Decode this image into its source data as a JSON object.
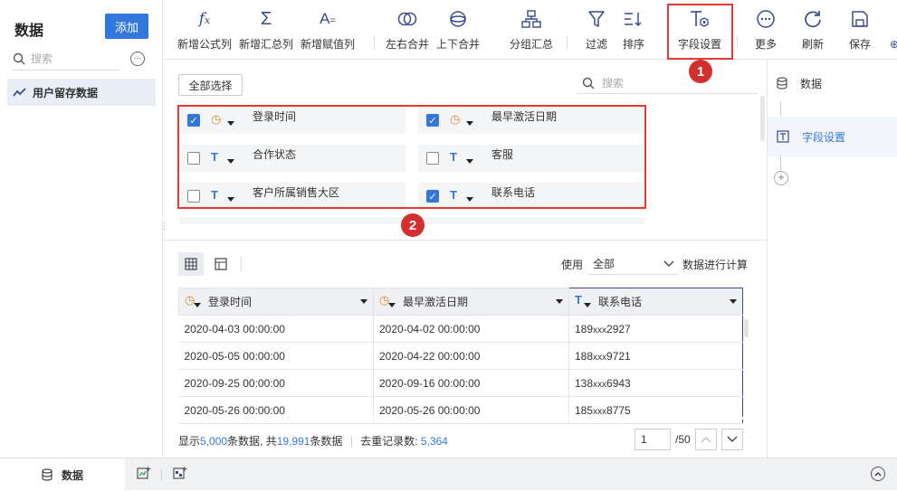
{
  "sidebar": {
    "title": "数据",
    "add_label": "添加",
    "search_placeholder": "搜索",
    "more_icon": "ellipsis-circle-icon",
    "items": [
      {
        "label": "用户留存数据",
        "icon": "line-chart-icon"
      }
    ]
  },
  "toolbar": {
    "items": [
      {
        "label": "新增公式列",
        "icon": "formula-icon"
      },
      {
        "label": "新增汇总列",
        "icon": "sigma-icon"
      },
      {
        "label": "新增赋值列",
        "icon": "assign-icon"
      },
      {
        "label": "左右合并",
        "icon": "merge-horizontal-icon"
      },
      {
        "label": "上下合并",
        "icon": "merge-vertical-icon"
      },
      {
        "label": "分组汇总",
        "icon": "group-summary-icon"
      },
      {
        "label": "过滤",
        "icon": "filter-icon"
      },
      {
        "label": "排序",
        "icon": "sort-icon"
      },
      {
        "label": "字段设置",
        "icon": "field-settings-icon"
      },
      {
        "label": "更多",
        "icon": "more-icon"
      },
      {
        "label": "刷新",
        "icon": "refresh-icon"
      },
      {
        "label": "保存",
        "icon": "save-icon"
      }
    ],
    "badge_1": "1"
  },
  "field_panel": {
    "select_all_label": "全部选择",
    "search_placeholder": "搜索",
    "badge_2": "2",
    "fields": [
      {
        "name": "登录时间",
        "type": "time",
        "checked": true
      },
      {
        "name": "最早激活日期",
        "type": "time",
        "checked": true
      },
      {
        "name": "合作状态",
        "type": "text",
        "checked": false
      },
      {
        "name": "客服",
        "type": "text",
        "checked": false
      },
      {
        "name": "客户所属销售大区",
        "type": "text",
        "checked": false
      },
      {
        "name": "联系电话",
        "type": "text",
        "checked": true
      }
    ]
  },
  "preview": {
    "use_label": "使用",
    "use_value": "全部",
    "calc_label": "数据进行计算",
    "columns": [
      {
        "name": "登录时间",
        "type": "time"
      },
      {
        "name": "最早激活日期",
        "type": "time"
      },
      {
        "name": "联系电话",
        "type": "text"
      }
    ],
    "rows": [
      {
        "c1": "2020-04-03 00:00:00",
        "c2": "2020-04-02 00:00:00",
        "p1": "189",
        "pm": "xxx",
        "p2": "2927"
      },
      {
        "c1": "2020-05-05 00:00:00",
        "c2": "2020-04-22 00:00:00",
        "p1": "188",
        "pm": "xxx",
        "p2": "9721"
      },
      {
        "c1": "2020-09-25 00:00:00",
        "c2": "2020-09-16 00:00:00",
        "p1": "138",
        "pm": "xxx",
        "p2": "6943"
      },
      {
        "c1": "2020-05-26 00:00:00",
        "c2": "2020-05-26 00:00:00",
        "p1": "185",
        "pm": "xxx",
        "p2": "8775"
      }
    ],
    "stats": {
      "shown_prefix": "显示",
      "shown_count": "5,000",
      "shown_mid": "条数据, 共",
      "total_count": "19,991",
      "total_suffix": "条数据",
      "dedup_label": "去重记录数:",
      "dedup_count": "5,364"
    },
    "pagination": {
      "page": "1",
      "total": "/50"
    }
  },
  "steps": [
    {
      "label": "数据",
      "icon": "database-icon"
    },
    {
      "label": "字段设置",
      "icon": "field-settings-step-icon"
    }
  ],
  "bottom": {
    "tab_label": "数据",
    "tab_icon": "database-icon"
  },
  "colors": {
    "accent": "#3377dd",
    "annotation_red": "#e53935",
    "clock": "#e8892c"
  }
}
